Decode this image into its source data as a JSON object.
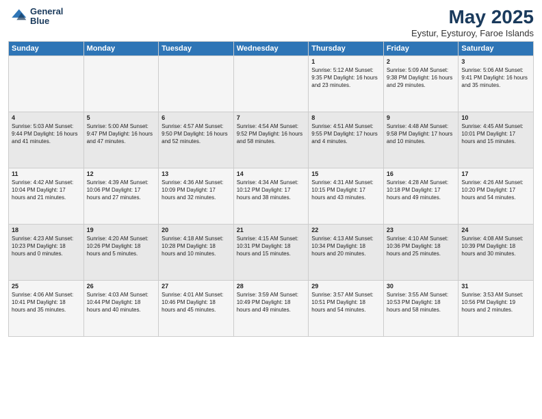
{
  "logo": {
    "line1": "General",
    "line2": "Blue"
  },
  "title": "May 2025",
  "subtitle": "Eystur, Eysturoy, Faroe Islands",
  "days_header": [
    "Sunday",
    "Monday",
    "Tuesday",
    "Wednesday",
    "Thursday",
    "Friday",
    "Saturday"
  ],
  "weeks": [
    [
      {
        "day": "",
        "content": ""
      },
      {
        "day": "",
        "content": ""
      },
      {
        "day": "",
        "content": ""
      },
      {
        "day": "",
        "content": ""
      },
      {
        "day": "1",
        "content": "Sunrise: 5:12 AM\nSunset: 9:35 PM\nDaylight: 16 hours\nand 23 minutes."
      },
      {
        "day": "2",
        "content": "Sunrise: 5:09 AM\nSunset: 9:38 PM\nDaylight: 16 hours\nand 29 minutes."
      },
      {
        "day": "3",
        "content": "Sunrise: 5:06 AM\nSunset: 9:41 PM\nDaylight: 16 hours\nand 35 minutes."
      }
    ],
    [
      {
        "day": "4",
        "content": "Sunrise: 5:03 AM\nSunset: 9:44 PM\nDaylight: 16 hours\nand 41 minutes."
      },
      {
        "day": "5",
        "content": "Sunrise: 5:00 AM\nSunset: 9:47 PM\nDaylight: 16 hours\nand 47 minutes."
      },
      {
        "day": "6",
        "content": "Sunrise: 4:57 AM\nSunset: 9:50 PM\nDaylight: 16 hours\nand 52 minutes."
      },
      {
        "day": "7",
        "content": "Sunrise: 4:54 AM\nSunset: 9:52 PM\nDaylight: 16 hours\nand 58 minutes."
      },
      {
        "day": "8",
        "content": "Sunrise: 4:51 AM\nSunset: 9:55 PM\nDaylight: 17 hours\nand 4 minutes."
      },
      {
        "day": "9",
        "content": "Sunrise: 4:48 AM\nSunset: 9:58 PM\nDaylight: 17 hours\nand 10 minutes."
      },
      {
        "day": "10",
        "content": "Sunrise: 4:45 AM\nSunset: 10:01 PM\nDaylight: 17 hours\nand 15 minutes."
      }
    ],
    [
      {
        "day": "11",
        "content": "Sunrise: 4:42 AM\nSunset: 10:04 PM\nDaylight: 17 hours\nand 21 minutes."
      },
      {
        "day": "12",
        "content": "Sunrise: 4:39 AM\nSunset: 10:06 PM\nDaylight: 17 hours\nand 27 minutes."
      },
      {
        "day": "13",
        "content": "Sunrise: 4:36 AM\nSunset: 10:09 PM\nDaylight: 17 hours\nand 32 minutes."
      },
      {
        "day": "14",
        "content": "Sunrise: 4:34 AM\nSunset: 10:12 PM\nDaylight: 17 hours\nand 38 minutes."
      },
      {
        "day": "15",
        "content": "Sunrise: 4:31 AM\nSunset: 10:15 PM\nDaylight: 17 hours\nand 43 minutes."
      },
      {
        "day": "16",
        "content": "Sunrise: 4:28 AM\nSunset: 10:18 PM\nDaylight: 17 hours\nand 49 minutes."
      },
      {
        "day": "17",
        "content": "Sunrise: 4:26 AM\nSunset: 10:20 PM\nDaylight: 17 hours\nand 54 minutes."
      }
    ],
    [
      {
        "day": "18",
        "content": "Sunrise: 4:23 AM\nSunset: 10:23 PM\nDaylight: 18 hours\nand 0 minutes."
      },
      {
        "day": "19",
        "content": "Sunrise: 4:20 AM\nSunset: 10:26 PM\nDaylight: 18 hours\nand 5 minutes."
      },
      {
        "day": "20",
        "content": "Sunrise: 4:18 AM\nSunset: 10:28 PM\nDaylight: 18 hours\nand 10 minutes."
      },
      {
        "day": "21",
        "content": "Sunrise: 4:15 AM\nSunset: 10:31 PM\nDaylight: 18 hours\nand 15 minutes."
      },
      {
        "day": "22",
        "content": "Sunrise: 4:13 AM\nSunset: 10:34 PM\nDaylight: 18 hours\nand 20 minutes."
      },
      {
        "day": "23",
        "content": "Sunrise: 4:10 AM\nSunset: 10:36 PM\nDaylight: 18 hours\nand 25 minutes."
      },
      {
        "day": "24",
        "content": "Sunrise: 4:08 AM\nSunset: 10:39 PM\nDaylight: 18 hours\nand 30 minutes."
      }
    ],
    [
      {
        "day": "25",
        "content": "Sunrise: 4:06 AM\nSunset: 10:41 PM\nDaylight: 18 hours\nand 35 minutes."
      },
      {
        "day": "26",
        "content": "Sunrise: 4:03 AM\nSunset: 10:44 PM\nDaylight: 18 hours\nand 40 minutes."
      },
      {
        "day": "27",
        "content": "Sunrise: 4:01 AM\nSunset: 10:46 PM\nDaylight: 18 hours\nand 45 minutes."
      },
      {
        "day": "28",
        "content": "Sunrise: 3:59 AM\nSunset: 10:49 PM\nDaylight: 18 hours\nand 49 minutes."
      },
      {
        "day": "29",
        "content": "Sunrise: 3:57 AM\nSunset: 10:51 PM\nDaylight: 18 hours\nand 54 minutes."
      },
      {
        "day": "30",
        "content": "Sunrise: 3:55 AM\nSunset: 10:53 PM\nDaylight: 18 hours\nand 58 minutes."
      },
      {
        "day": "31",
        "content": "Sunrise: 3:53 AM\nSunset: 10:56 PM\nDaylight: 19 hours\nand 2 minutes."
      }
    ]
  ]
}
